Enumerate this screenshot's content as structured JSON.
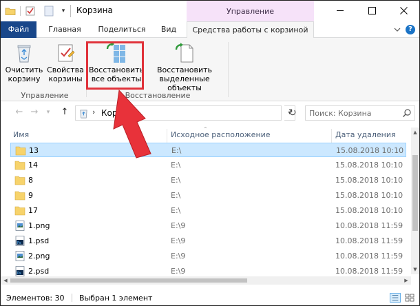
{
  "window": {
    "title": "Корзина",
    "context_tab_group": "Управление"
  },
  "tabs": {
    "file": "Файл",
    "home": "Главная",
    "share": "Поделиться",
    "view": "Вид",
    "manage": "Средства работы с корзиной",
    "help": "?"
  },
  "ribbon": {
    "empty_bin": "Очистить\nкорзину",
    "bin_properties": "Свойства\nкорзины",
    "restore_all": "Восстановить\nвсе объекты",
    "restore_selected": "Восстановить\nвыделенные объекты",
    "group_manage": "Управление",
    "group_restore": "Восстановление"
  },
  "address": {
    "path": "Корзина",
    "search_placeholder": "Поиск: Корзина"
  },
  "columns": {
    "name": "Имя",
    "original_location": "Исходное расположение",
    "date_deleted": "Дата удаления"
  },
  "files": [
    {
      "name": "13",
      "type": "folder",
      "location": "E:\\",
      "date": "15.08.2018 10:10",
      "selected": true
    },
    {
      "name": "14",
      "type": "folder",
      "location": "E:\\",
      "date": "15.08.2018 10:10",
      "selected": false
    },
    {
      "name": "8",
      "type": "folder",
      "location": "E:\\",
      "date": "15.08.2018 10:10",
      "selected": false
    },
    {
      "name": "9",
      "type": "folder",
      "location": "E:\\",
      "date": "15.08.2018 10:10",
      "selected": false
    },
    {
      "name": "17",
      "type": "folder",
      "location": "E:\\",
      "date": "15.08.2018 10:10",
      "selected": false
    },
    {
      "name": "1.png",
      "type": "png",
      "location": "E:\\9",
      "date": "10.08.2018 11:59",
      "selected": false
    },
    {
      "name": "1.psd",
      "type": "psd",
      "location": "E:\\9",
      "date": "10.08.2018 11:59",
      "selected": false
    },
    {
      "name": "2.png",
      "type": "png",
      "location": "E:\\9",
      "date": "10.08.2018 11:59",
      "selected": false
    },
    {
      "name": "2.psd",
      "type": "psd",
      "location": "E:\\9",
      "date": "10.08.2018 11:59",
      "selected": false
    }
  ],
  "status": {
    "count": "Элементов: 30",
    "selection": "Выбран 1 элемент"
  },
  "colors": {
    "file_tab": "#19478a",
    "context_tab": "#f6e2f9",
    "selection": "#cce8ff",
    "highlight": "#e0323a",
    "folder": "#f7d36b"
  }
}
